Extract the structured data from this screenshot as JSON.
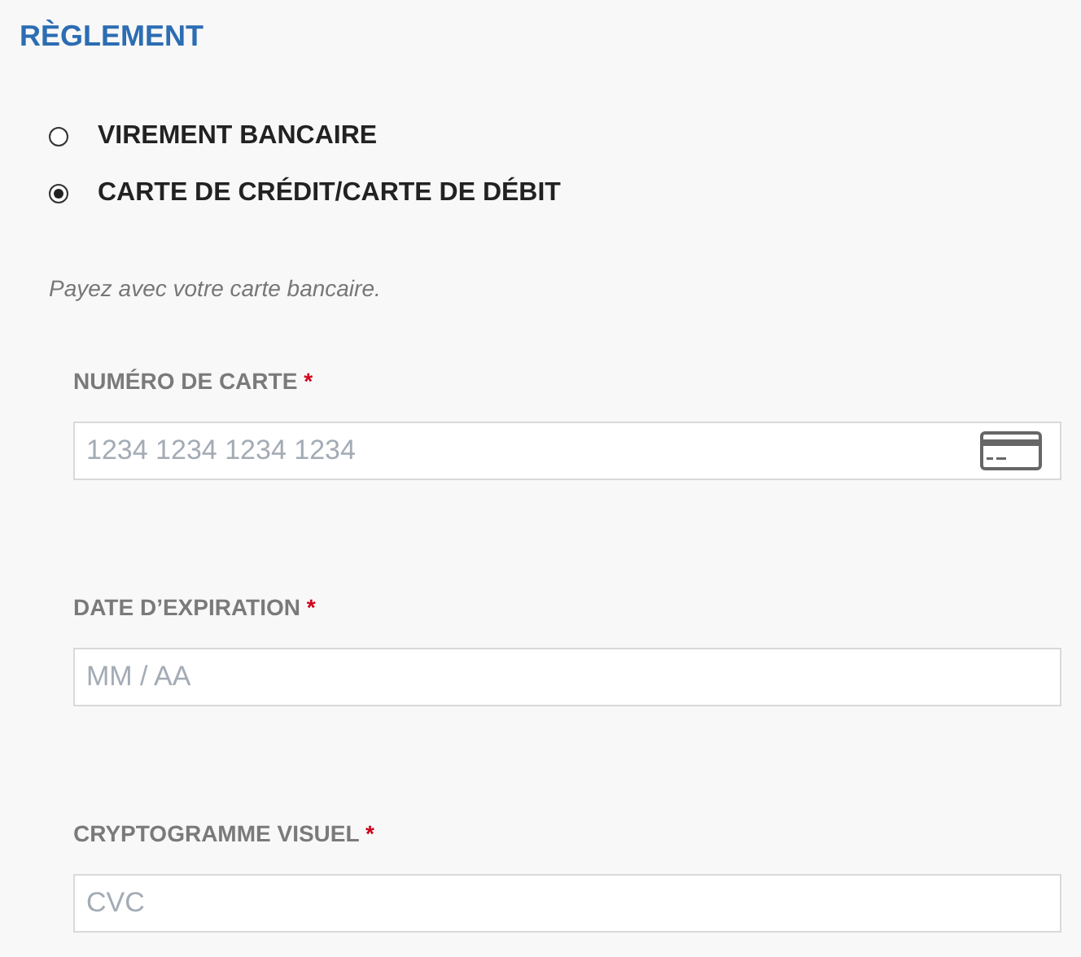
{
  "section_title": "RÈGLEMENT",
  "payment_methods": [
    {
      "label": "VIREMENT BANCAIRE",
      "selected": false
    },
    {
      "label": "CARTE DE CRÉDIT/CARTE DE DÉBIT",
      "selected": true
    }
  ],
  "description": "Payez avec votre carte bancaire.",
  "fields": [
    {
      "label": "NUMÉRO DE CARTE",
      "required_mark": "*",
      "placeholder": "1234 1234 1234 1234",
      "card_icon": true
    },
    {
      "label": "DATE D’EXPIRATION",
      "required_mark": "*",
      "placeholder": "MM / AA",
      "card_icon": false
    },
    {
      "label": "CRYPTOGRAMME VISUEL",
      "required_mark": "*",
      "placeholder": "CVC",
      "card_icon": false
    }
  ]
}
